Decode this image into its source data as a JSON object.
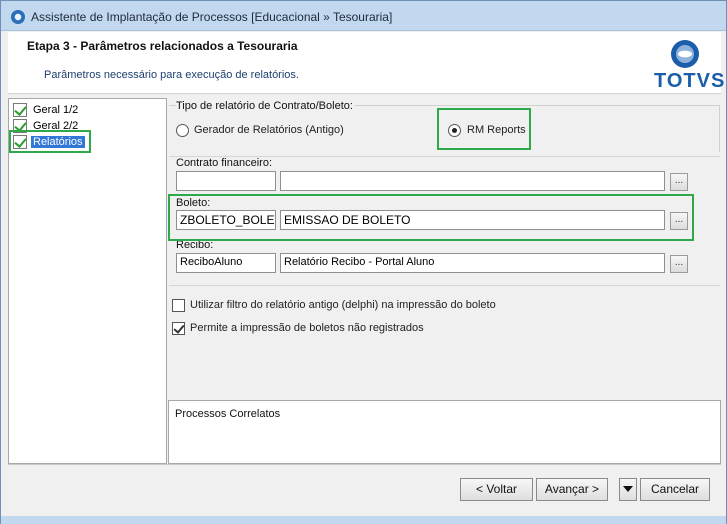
{
  "window": {
    "title": "Assistente de Implantação de Processos [Educacional » Tesouraria]"
  },
  "header": {
    "step_title": "Etapa 3 - Parâmetros relacionados a Tesouraria",
    "description": "Parâmetros necessário para execução de relatórios.",
    "logo_text": "TOTVS"
  },
  "tree": {
    "items": [
      {
        "label": "Geral 1/2",
        "selected": false
      },
      {
        "label": "Geral 2/2",
        "selected": false
      },
      {
        "label": "Relatórios",
        "selected": true
      }
    ]
  },
  "report_type": {
    "label": "Tipo de relatório de Contrato/Boleto:",
    "options": [
      {
        "label": "Gerador de Relatórios (Antigo)",
        "selected": false
      },
      {
        "label": "RM Reports",
        "selected": true
      }
    ]
  },
  "contrato": {
    "label": "Contrato financeiro:",
    "code": "",
    "description": "",
    "lookup_label": "..."
  },
  "boleto": {
    "label": "Boleto:",
    "code": "ZBOLETO_BOLETO",
    "description": "EMISSAO DE BOLETO",
    "lookup_label": "..."
  },
  "recibo": {
    "label": "Recibo:",
    "code": "ReciboAluno",
    "description": "Relatório Recibo - Portal Aluno",
    "lookup_label": "..."
  },
  "options": {
    "filter_old": {
      "label": "Utilizar filtro do relatório antigo (delphi) na impressão do boleto",
      "checked": false
    },
    "allow_unregistered": {
      "label": "Permite a impressão de boletos não registrados",
      "checked": true
    }
  },
  "related": {
    "title": "Processos Correlatos"
  },
  "footer": {
    "back_label": "< Voltar",
    "next_label": "Avançar >",
    "cancel_label": "Cancelar"
  },
  "colors": {
    "highlight": "#2fa84a",
    "selection": "#3077d8",
    "brand": "#1a5da8"
  }
}
